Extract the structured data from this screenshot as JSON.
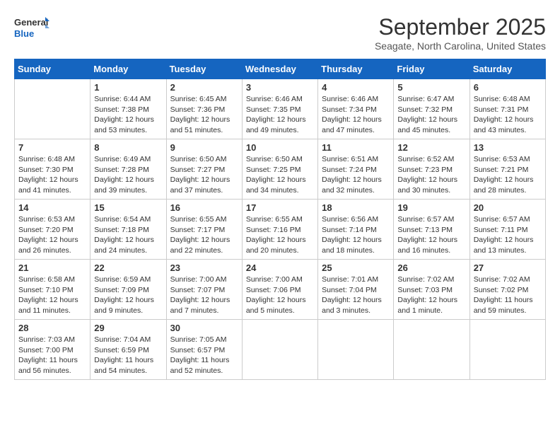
{
  "header": {
    "logo_line1": "General",
    "logo_line2": "Blue",
    "month": "September 2025",
    "location": "Seagate, North Carolina, United States"
  },
  "weekdays": [
    "Sunday",
    "Monday",
    "Tuesday",
    "Wednesday",
    "Thursday",
    "Friday",
    "Saturday"
  ],
  "weeks": [
    [
      {
        "day": "",
        "info": ""
      },
      {
        "day": "1",
        "info": "Sunrise: 6:44 AM\nSunset: 7:38 PM\nDaylight: 12 hours\nand 53 minutes."
      },
      {
        "day": "2",
        "info": "Sunrise: 6:45 AM\nSunset: 7:36 PM\nDaylight: 12 hours\nand 51 minutes."
      },
      {
        "day": "3",
        "info": "Sunrise: 6:46 AM\nSunset: 7:35 PM\nDaylight: 12 hours\nand 49 minutes."
      },
      {
        "day": "4",
        "info": "Sunrise: 6:46 AM\nSunset: 7:34 PM\nDaylight: 12 hours\nand 47 minutes."
      },
      {
        "day": "5",
        "info": "Sunrise: 6:47 AM\nSunset: 7:32 PM\nDaylight: 12 hours\nand 45 minutes."
      },
      {
        "day": "6",
        "info": "Sunrise: 6:48 AM\nSunset: 7:31 PM\nDaylight: 12 hours\nand 43 minutes."
      }
    ],
    [
      {
        "day": "7",
        "info": "Sunrise: 6:48 AM\nSunset: 7:30 PM\nDaylight: 12 hours\nand 41 minutes."
      },
      {
        "day": "8",
        "info": "Sunrise: 6:49 AM\nSunset: 7:28 PM\nDaylight: 12 hours\nand 39 minutes."
      },
      {
        "day": "9",
        "info": "Sunrise: 6:50 AM\nSunset: 7:27 PM\nDaylight: 12 hours\nand 37 minutes."
      },
      {
        "day": "10",
        "info": "Sunrise: 6:50 AM\nSunset: 7:25 PM\nDaylight: 12 hours\nand 34 minutes."
      },
      {
        "day": "11",
        "info": "Sunrise: 6:51 AM\nSunset: 7:24 PM\nDaylight: 12 hours\nand 32 minutes."
      },
      {
        "day": "12",
        "info": "Sunrise: 6:52 AM\nSunset: 7:23 PM\nDaylight: 12 hours\nand 30 minutes."
      },
      {
        "day": "13",
        "info": "Sunrise: 6:53 AM\nSunset: 7:21 PM\nDaylight: 12 hours\nand 28 minutes."
      }
    ],
    [
      {
        "day": "14",
        "info": "Sunrise: 6:53 AM\nSunset: 7:20 PM\nDaylight: 12 hours\nand 26 minutes."
      },
      {
        "day": "15",
        "info": "Sunrise: 6:54 AM\nSunset: 7:18 PM\nDaylight: 12 hours\nand 24 minutes."
      },
      {
        "day": "16",
        "info": "Sunrise: 6:55 AM\nSunset: 7:17 PM\nDaylight: 12 hours\nand 22 minutes."
      },
      {
        "day": "17",
        "info": "Sunrise: 6:55 AM\nSunset: 7:16 PM\nDaylight: 12 hours\nand 20 minutes."
      },
      {
        "day": "18",
        "info": "Sunrise: 6:56 AM\nSunset: 7:14 PM\nDaylight: 12 hours\nand 18 minutes."
      },
      {
        "day": "19",
        "info": "Sunrise: 6:57 AM\nSunset: 7:13 PM\nDaylight: 12 hours\nand 16 minutes."
      },
      {
        "day": "20",
        "info": "Sunrise: 6:57 AM\nSunset: 7:11 PM\nDaylight: 12 hours\nand 13 minutes."
      }
    ],
    [
      {
        "day": "21",
        "info": "Sunrise: 6:58 AM\nSunset: 7:10 PM\nDaylight: 12 hours\nand 11 minutes."
      },
      {
        "day": "22",
        "info": "Sunrise: 6:59 AM\nSunset: 7:09 PM\nDaylight: 12 hours\nand 9 minutes."
      },
      {
        "day": "23",
        "info": "Sunrise: 7:00 AM\nSunset: 7:07 PM\nDaylight: 12 hours\nand 7 minutes."
      },
      {
        "day": "24",
        "info": "Sunrise: 7:00 AM\nSunset: 7:06 PM\nDaylight: 12 hours\nand 5 minutes."
      },
      {
        "day": "25",
        "info": "Sunrise: 7:01 AM\nSunset: 7:04 PM\nDaylight: 12 hours\nand 3 minutes."
      },
      {
        "day": "26",
        "info": "Sunrise: 7:02 AM\nSunset: 7:03 PM\nDaylight: 12 hours\nand 1 minute."
      },
      {
        "day": "27",
        "info": "Sunrise: 7:02 AM\nSunset: 7:02 PM\nDaylight: 11 hours\nand 59 minutes."
      }
    ],
    [
      {
        "day": "28",
        "info": "Sunrise: 7:03 AM\nSunset: 7:00 PM\nDaylight: 11 hours\nand 56 minutes."
      },
      {
        "day": "29",
        "info": "Sunrise: 7:04 AM\nSunset: 6:59 PM\nDaylight: 11 hours\nand 54 minutes."
      },
      {
        "day": "30",
        "info": "Sunrise: 7:05 AM\nSunset: 6:57 PM\nDaylight: 11 hours\nand 52 minutes."
      },
      {
        "day": "",
        "info": ""
      },
      {
        "day": "",
        "info": ""
      },
      {
        "day": "",
        "info": ""
      },
      {
        "day": "",
        "info": ""
      }
    ]
  ]
}
